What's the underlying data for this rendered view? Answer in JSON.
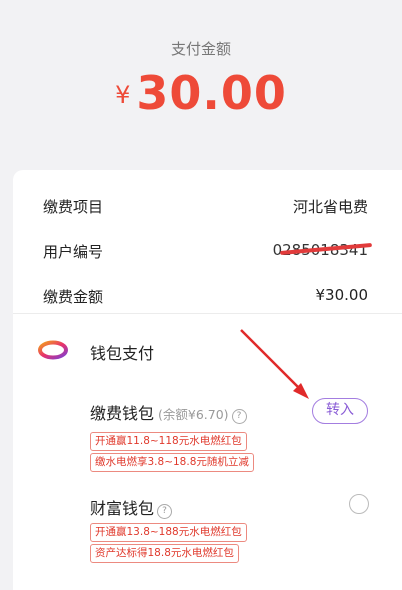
{
  "header": {
    "title": "支付金额",
    "currency": "¥",
    "amount": "30.00"
  },
  "details": {
    "project_label": "缴费项目",
    "project_value": "河北省电费",
    "user_label": "用户编号",
    "user_value": "0285018341",
    "fee_label": "缴费金额",
    "fee_value": "¥30.00"
  },
  "wallet": {
    "title": "钱包支付",
    "logo_icon": "wallet-logo-icon",
    "options": [
      {
        "title": "缴费钱包",
        "balance": "(余额¥6.70)",
        "action": "转入",
        "tags": [
          "开通赢11.8~118元水电燃红包",
          "缴水电燃享3.8~18.8元随机立减"
        ]
      },
      {
        "title": "财富钱包",
        "tags": [
          "开通赢13.8~188元水电燃红包",
          "资产达标得18.8元水电燃红包"
        ]
      }
    ]
  },
  "colors": {
    "accent_red": "#ee4a38",
    "button_purple": "#8a5cd6",
    "background": "#f2f2f4"
  }
}
